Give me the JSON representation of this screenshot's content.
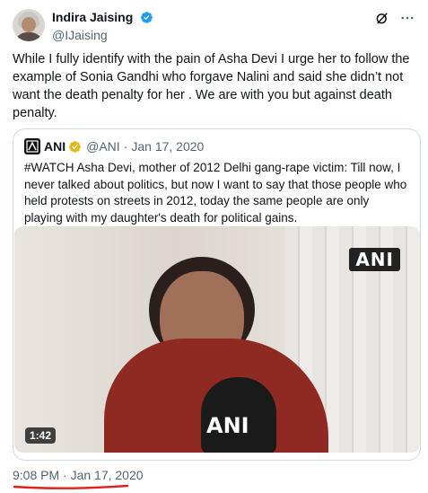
{
  "author": {
    "display_name": "Indira Jaising",
    "handle": "@IJaising",
    "verified_icon": "blue-verified-badge",
    "avatar_icon": "profile-photo"
  },
  "header_actions": {
    "grok_icon": "grok-icon",
    "more_icon": "more-dots-icon"
  },
  "tweet": {
    "text": "While I fully identify with the pain of Asha Devi I urge her to follow the example of Sonia Gandhi who forgave Nalini and said she didn’t not want the death penalty for her . We are with you but against death penalty."
  },
  "quote": {
    "name": "ANI",
    "handle": "@ANI",
    "date": "Jan 17, 2020",
    "separator": "·",
    "badge_icon": "gold-verified-badge",
    "text": "#WATCH Asha Devi, mother of 2012 Delhi gang-rape victim:  Till now, I never talked about politics, but now I want to say that those people who held protests on streets in 2012, today the same people are only playing with my daughter's death for political gains.",
    "video": {
      "duration": "1:42",
      "watermark": "ANI",
      "mic_label": "ANI"
    }
  },
  "timestamp": "9:08 PM · Jan 17, 2020",
  "colors": {
    "text": "#0f1419",
    "muted": "#536471",
    "border": "#cfd9de",
    "verified_blue": "#1d9bf0",
    "gold": "#e2b719",
    "annotation_red": "#e0201a"
  }
}
